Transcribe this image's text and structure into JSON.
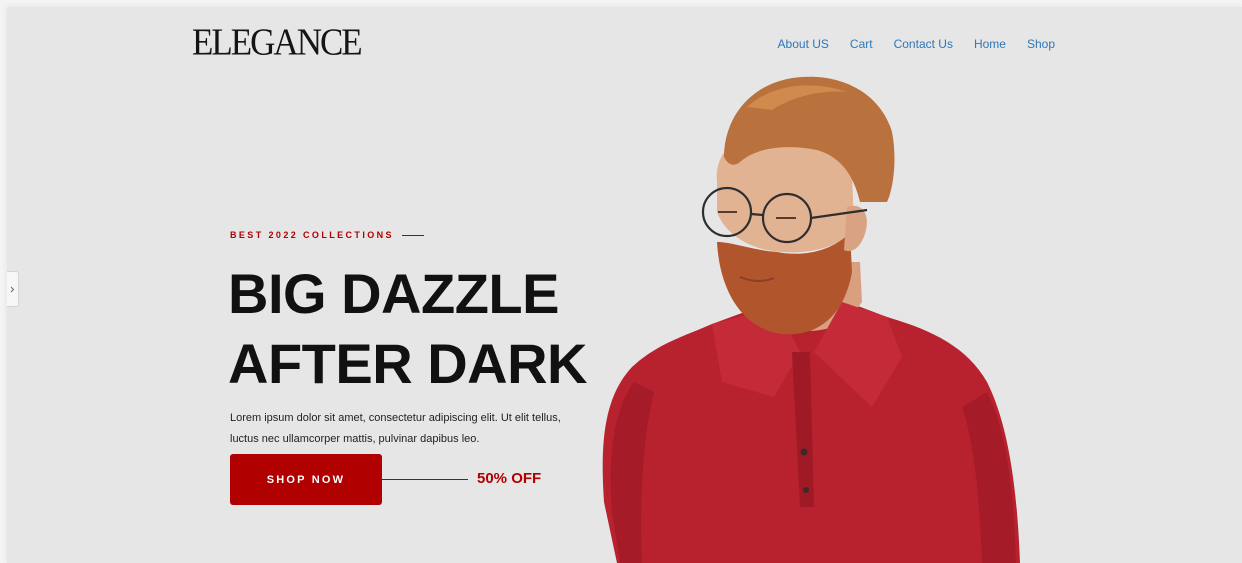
{
  "brand": {
    "logo_text": "ELEGANCE"
  },
  "nav": {
    "items": [
      "About US",
      "Cart",
      "Contact Us",
      "Home",
      "Shop"
    ]
  },
  "hero": {
    "eyebrow": "BEST 2022 COLLECTIONS",
    "headline_line1": "BIG DAZZLE",
    "headline_line2": "AFTER DARK",
    "description": "Lorem ipsum dolor sit amet, consectetur adipiscing elit. Ut elit tellus, luctus nec ullamcorper mattis, pulvinar dapibus leo.",
    "cta_label": "SHOP NOW",
    "offer_text": "50% OFF"
  },
  "colors": {
    "background": "#e6e6e6",
    "accent": "#b00000",
    "nav_link": "#2e77ba",
    "heading": "#111111"
  },
  "icons": {
    "side_tab": "chevron-right-icon",
    "hero_image": "model-photo"
  }
}
